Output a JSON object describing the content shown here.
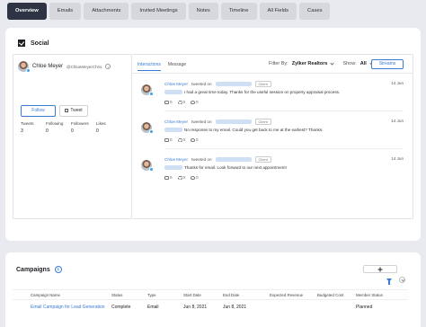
{
  "tabs": [
    "Overview",
    "Emails",
    "Attachments",
    "Invited Meetings",
    "Notes",
    "Timeline",
    "All Fields",
    "Cases"
  ],
  "social": {
    "title": "Social",
    "profile": {
      "name": "Chloe Meyer",
      "handle": "@ChloeMeyerChris",
      "follow_label": "Follow",
      "tweet_label": "Tweet",
      "stats": [
        {
          "label": "Tweets",
          "value": "3"
        },
        {
          "label": "Following",
          "value": "0"
        },
        {
          "label": "Followers",
          "value": "0"
        },
        {
          "label": "Likes",
          "value": "0"
        }
      ]
    },
    "feed_tabs": [
      "Interactions",
      "Message"
    ],
    "filter_label": "Filter By:",
    "filter_value": "Zylker Realtors",
    "show_label": "Show:",
    "show_value": "All",
    "streams_label": "Streams",
    "posts": [
      {
        "author": "Chloe Meyer",
        "verb": "tweeted on",
        "badge": "Client",
        "date": "14 Jun",
        "text": "I had a great time today. Thanks for the useful session on property appraisal process.",
        "counts": {
          "reply": "0",
          "retweet": "0",
          "like": "0"
        }
      },
      {
        "author": "Chloe Meyer",
        "verb": "tweeted on",
        "badge": "Client",
        "date": "14 Jun",
        "text": "No response to my email. Could you get back to me at the earliest? Thanks.",
        "counts": {
          "reply": "0",
          "retweet": "0",
          "like": "0"
        }
      },
      {
        "author": "Chloe Meyer",
        "verb": "tweeted on",
        "badge": "Client",
        "date": "14 Jun",
        "text": "Thanks for email. Look forward to our next appointment!",
        "counts": {
          "reply": "0",
          "retweet": "0",
          "like": "0"
        }
      }
    ]
  },
  "campaigns": {
    "title": "Campaigns",
    "count": "1",
    "columns": [
      "Campaign Name",
      "Status",
      "Type",
      "Start Date",
      "End Date",
      "Expected Revenue",
      "Budgeted Cost",
      "Member Status"
    ],
    "rows": [
      [
        "Email Campaign for Lead Generation",
        "Complete",
        "Email",
        "Jun 8, 2021",
        "Jun 8, 2021",
        "",
        "",
        "Planned"
      ]
    ]
  },
  "colors": {
    "accent": "#3a7bd5",
    "tab_active": "#2e3443",
    "background": "#e9eaef"
  }
}
